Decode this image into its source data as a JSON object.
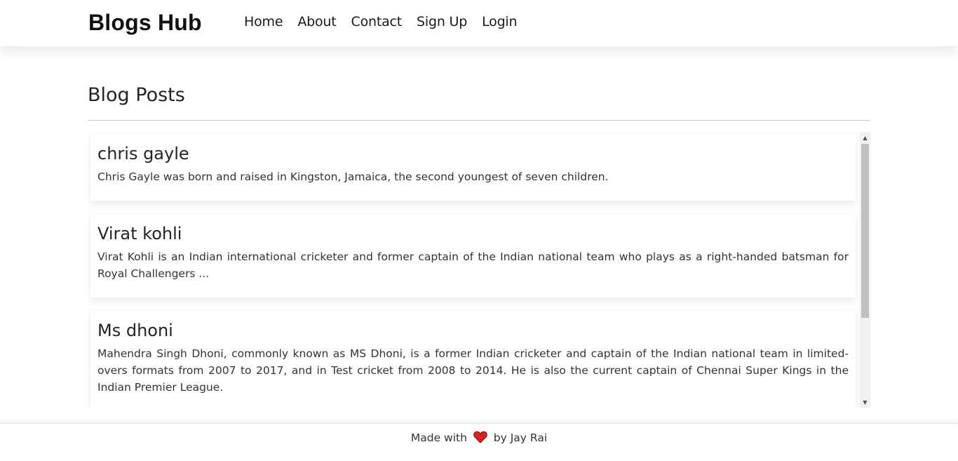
{
  "navbar": {
    "brand": "Blogs Hub",
    "links": [
      "Home",
      "About",
      "Contact",
      "Sign Up",
      "Login"
    ]
  },
  "main": {
    "title": "Blog Posts",
    "posts": [
      {
        "title": "chris gayle",
        "body": "Chris Gayle was born and raised in Kingston, Jamaica, the second youngest of seven children."
      },
      {
        "title": "Virat kohli",
        "body": "Virat Kohli is an Indian international cricketer and former captain of the Indian national team who plays as a right-handed batsman for Royal Challengers ..."
      },
      {
        "title": "Ms dhoni",
        "body": "Mahendra Singh Dhoni, commonly known as MS Dhoni, is a former Indian cricketer and captain of the Indian national team in limited-overs formats from 2007 to 2017, and in Test cricket from 2008 to 2014. He is also the current captain of Chennai Super Kings in the Indian Premier League."
      }
    ]
  },
  "footer": {
    "made_with": "Made with",
    "by": "by Jay Rai",
    "heart_icon": "heart-icon",
    "heart_color": "#e0201f"
  }
}
